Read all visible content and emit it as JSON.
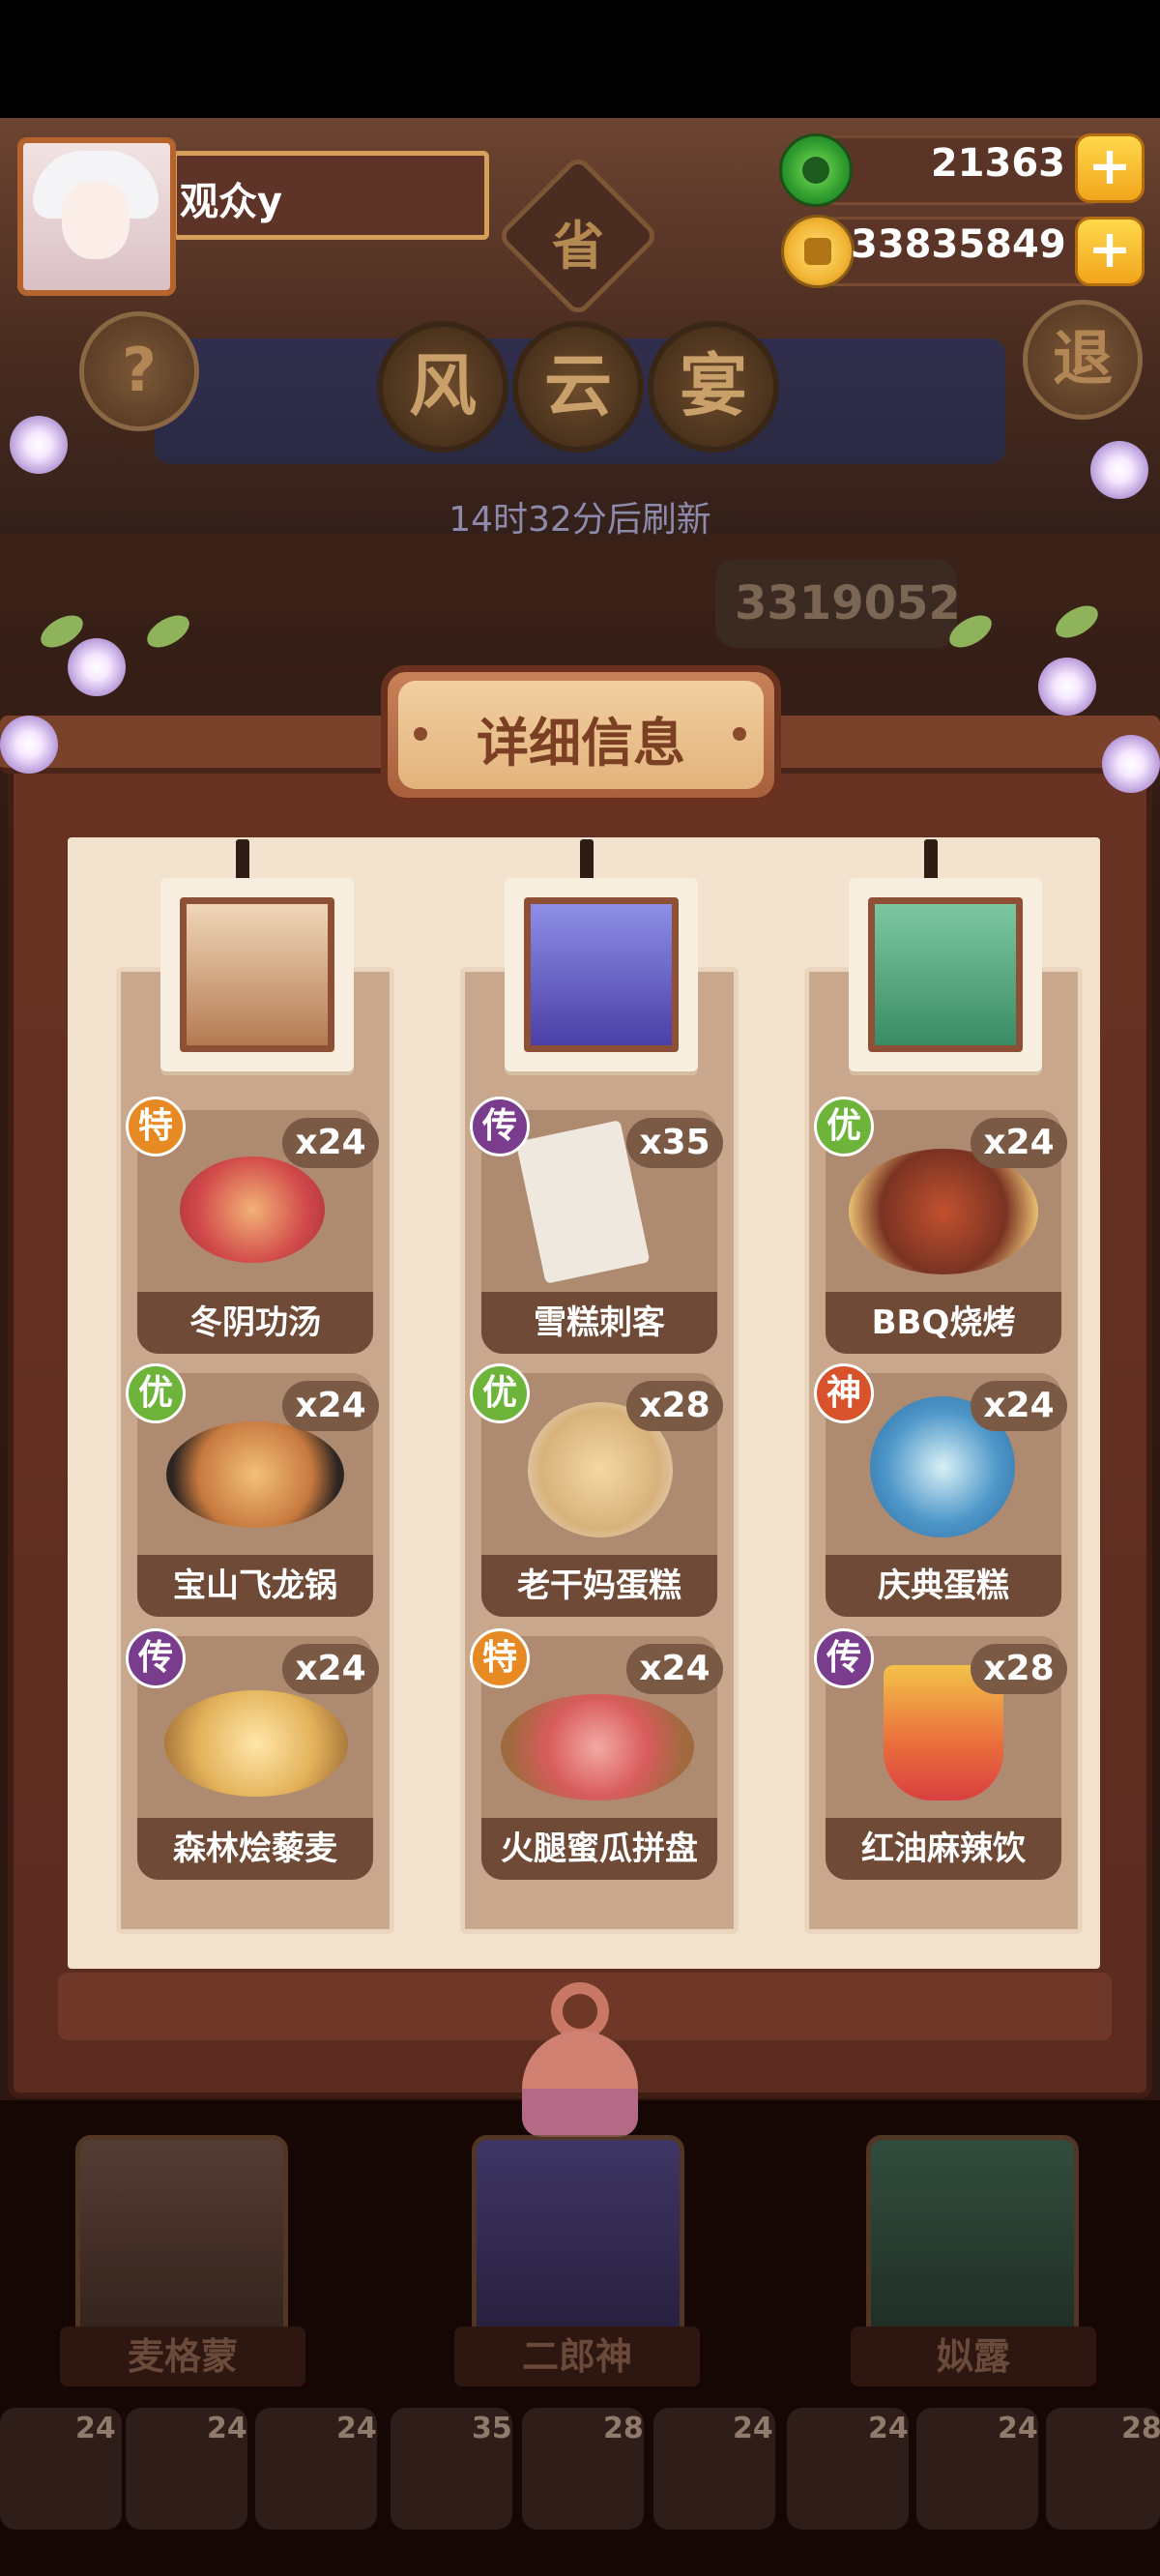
{
  "player": {
    "name": "观众y"
  },
  "currency": {
    "jade": "21363",
    "coins": "33835849",
    "plus": "+"
  },
  "badge": "省",
  "help_label": "?",
  "exit_label": "退",
  "title_chars": [
    "风",
    "云",
    "宴"
  ],
  "refresh_text": "14时32分后刷新",
  "score_text": "3319052",
  "detail_title": "详细信息",
  "columns": [
    {
      "chef": "麦格蒙",
      "dishes": [
        {
          "tag": "特",
          "count": "x24",
          "name": "冬阴功汤"
        },
        {
          "tag": "优",
          "count": "x24",
          "name": "宝山飞龙锅"
        },
        {
          "tag": "传",
          "count": "x24",
          "name": "森林烩藜麦"
        }
      ]
    },
    {
      "chef": "二郎神",
      "dishes": [
        {
          "tag": "传",
          "count": "x35",
          "name": "雪糕刺客"
        },
        {
          "tag": "优",
          "count": "x28",
          "name": "老干妈蛋糕"
        },
        {
          "tag": "特",
          "count": "x24",
          "name": "火腿蜜瓜拼盘"
        }
      ]
    },
    {
      "chef": "姒露",
      "dishes": [
        {
          "tag": "优",
          "count": "x24",
          "name": "BBQ烧烤"
        },
        {
          "tag": "神",
          "count": "x24",
          "name": "庆典蛋糕"
        },
        {
          "tag": "传",
          "count": "x28",
          "name": "红油麻辣饮"
        }
      ]
    }
  ],
  "bottom_chefs": [
    "麦格蒙",
    "二郎神",
    "姒露"
  ],
  "mini_counts": [
    "24",
    "24",
    "24",
    "35",
    "28",
    "24",
    "24",
    "24",
    "28"
  ],
  "colors": {
    "tag_te": "#e88a23",
    "tag_chuan": "#7a3c8c",
    "tag_you": "#6eb43a",
    "tag_shen": "#d8532c"
  }
}
